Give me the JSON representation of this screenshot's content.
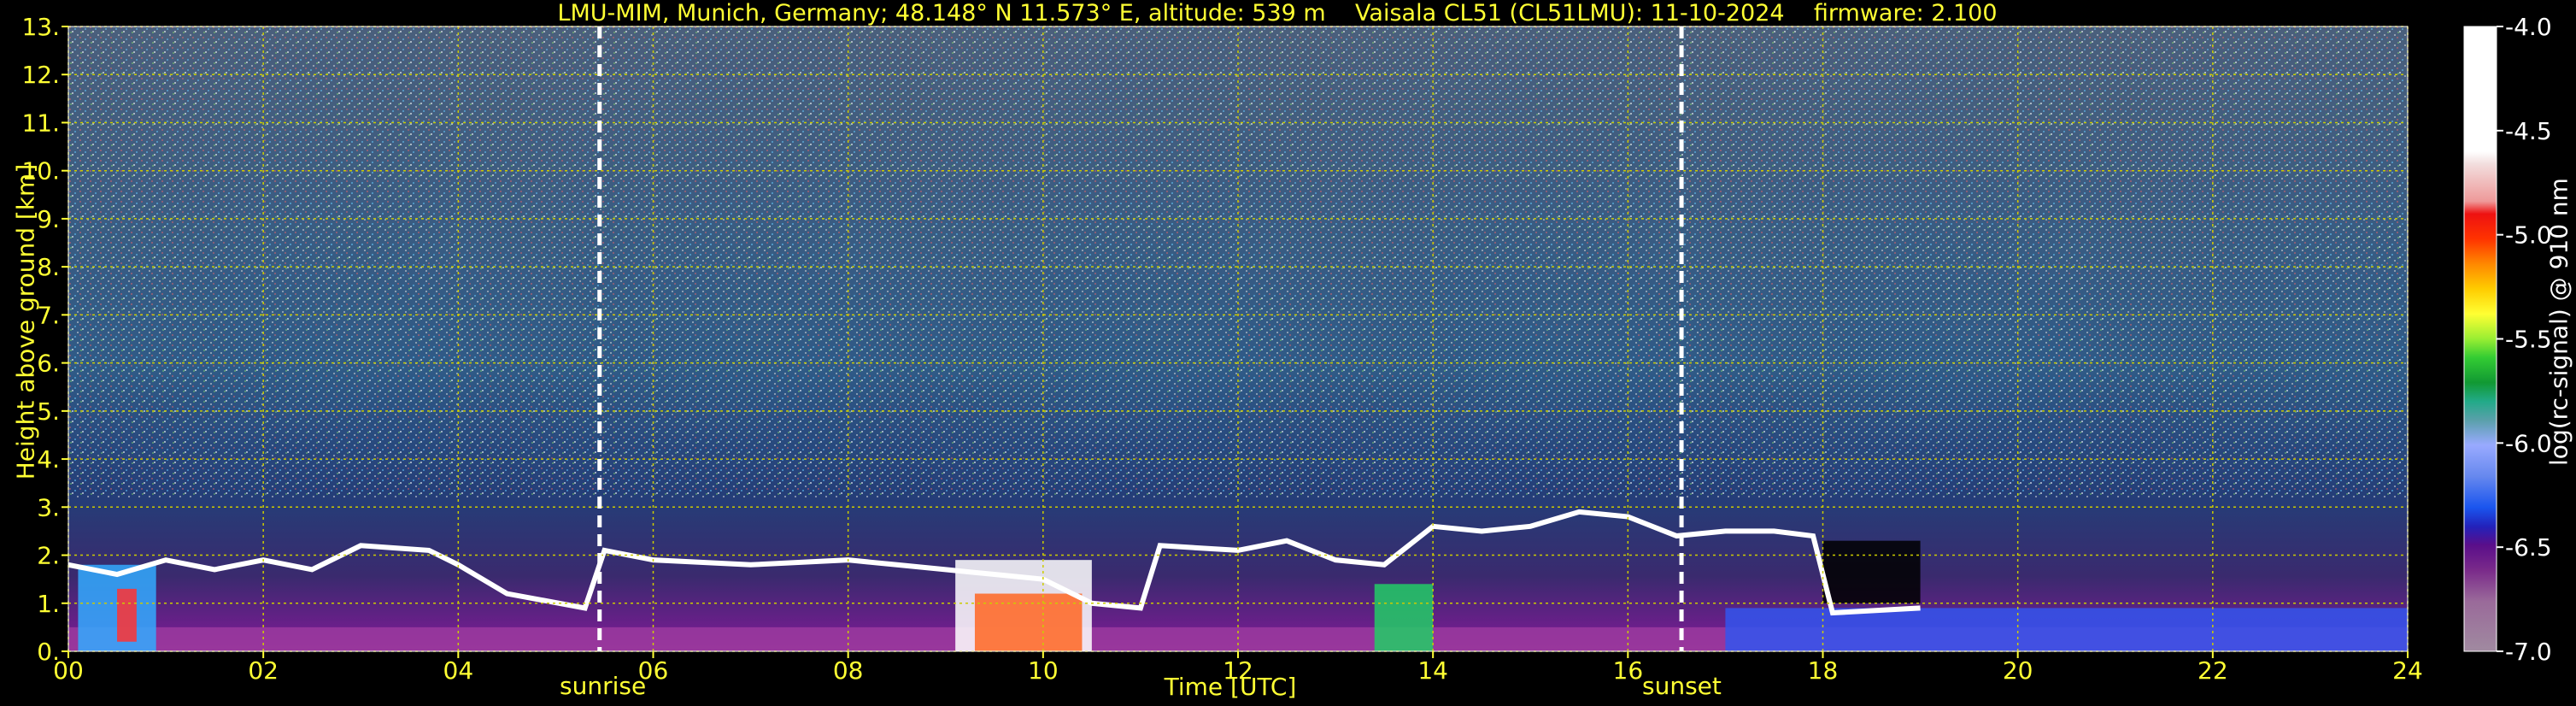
{
  "title": "LMU-MIM, Munich, Germany; 48.148° N 11.573° E, altitude: 539 m    Vaisala CL51 (CL51LMU): 11-10-2024    firmware: 2.100",
  "chart_data": {
    "type": "heatmap",
    "xlabel": "Time [UTC]",
    "ylabel": "Height above ground [km]",
    "colorbar_label": "log(rc-signal) @ 910 nm",
    "xlim": [
      0,
      24
    ],
    "ylim": [
      0,
      13
    ],
    "x_ticks": [
      "00",
      "02",
      "04",
      "06",
      "08",
      "10",
      "12",
      "14",
      "16",
      "18",
      "20",
      "22",
      "24"
    ],
    "y_ticks": [
      "0.",
      "1.",
      "2.",
      "3.",
      "4.",
      "5.",
      "6.",
      "7.",
      "8.",
      "9.",
      "10.",
      "11.",
      "12.",
      "13."
    ],
    "colorbar_range": [
      -7.0,
      -4.0
    ],
    "colorbar_ticks": [
      "-4.0",
      "-4.5",
      "-5.0",
      "-5.5",
      "-6.0",
      "-6.5",
      "-7.0"
    ],
    "grid": true,
    "annotations": [
      {
        "label": "sunrise",
        "x": 5.45
      },
      {
        "label": "sunset",
        "x": 16.55
      }
    ]
  }
}
